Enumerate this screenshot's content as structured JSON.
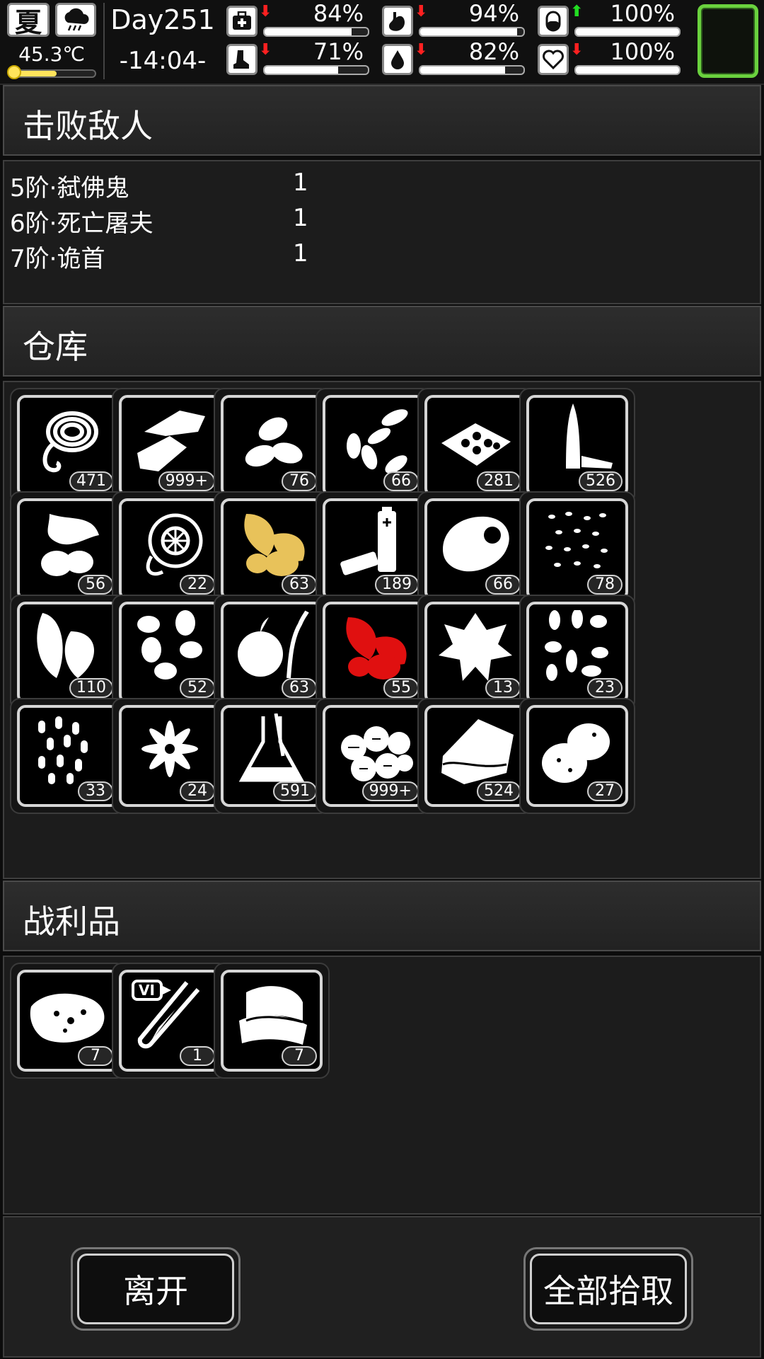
{
  "hud": {
    "season": "夏",
    "weather_icon": "storm-cloud-icon",
    "temperature": "45.3℃",
    "temperature_level": 0.55,
    "day": "Day251",
    "time": "-14:04-",
    "stats": [
      {
        "id": "health",
        "icon": "medkit-icon",
        "arrow": "down",
        "percent": "84%",
        "value": 0.84
      },
      {
        "id": "hunger",
        "icon": "stomach-icon",
        "arrow": "down",
        "percent": "94%",
        "value": 0.94
      },
      {
        "id": "sanity",
        "icon": "pill-icon",
        "arrow": "up",
        "percent": "100%",
        "value": 1.0
      },
      {
        "id": "stamina",
        "icon": "boot-icon",
        "arrow": "down",
        "percent": "71%",
        "value": 0.71
      },
      {
        "id": "thirst",
        "icon": "water-drop-icon",
        "arrow": "down",
        "percent": "82%",
        "value": 0.82
      },
      {
        "id": "mood",
        "icon": "heart-icon",
        "arrow": "down",
        "percent": "100%",
        "value": 1.0
      }
    ],
    "colors": {
      "arrow_down": "#ff2020",
      "arrow_up": "#22dd22",
      "portrait_frame": "#6ad13e",
      "temp_bar": "#ffe45c"
    }
  },
  "defeated": {
    "title": "击败敌人",
    "rows": [
      {
        "name": "5阶·弑佛鬼",
        "count": "1"
      },
      {
        "name": "6阶·死亡屠夫",
        "count": "1"
      },
      {
        "name": "7阶·诡首",
        "count": "1"
      }
    ]
  },
  "warehouse": {
    "title": "仓库",
    "items": [
      {
        "icon": "rope-icon",
        "count": "471"
      },
      {
        "icon": "cloth-scrap-icon",
        "count": "999+"
      },
      {
        "icon": "almond-icon",
        "count": "76"
      },
      {
        "icon": "seeds-icon",
        "count": "66"
      },
      {
        "icon": "tray-icon",
        "count": "281"
      },
      {
        "icon": "bullet-icon",
        "count": "526"
      },
      {
        "icon": "herb-pods-icon",
        "count": "56"
      },
      {
        "icon": "sliced-fruit-icon",
        "count": "22"
      },
      {
        "icon": "yellow-leaves-icon",
        "count": "63"
      },
      {
        "icon": "battery-icon",
        "count": "189"
      },
      {
        "icon": "meat-icon",
        "count": "66"
      },
      {
        "icon": "small-seeds-icon",
        "count": "78"
      },
      {
        "icon": "leaf-icon",
        "count": "110"
      },
      {
        "icon": "beans-icon",
        "count": "52"
      },
      {
        "icon": "root-vegetable-icon",
        "count": "63"
      },
      {
        "icon": "red-leaves-icon",
        "count": "55"
      },
      {
        "icon": "mint-icon",
        "count": "13"
      },
      {
        "icon": "sprouts-icon",
        "count": "23"
      },
      {
        "icon": "grain-icon",
        "count": "33"
      },
      {
        "icon": "flower-icon",
        "count": "24"
      },
      {
        "icon": "flask-icon",
        "count": "591"
      },
      {
        "icon": "cotton-balls-icon",
        "count": "999+"
      },
      {
        "icon": "fabric-icon",
        "count": "524"
      },
      {
        "icon": "potato-icon",
        "count": "27"
      }
    ],
    "colors": {
      "yellow_leaves": "#e8c25a",
      "red_leaves": "#e01010"
    }
  },
  "loot": {
    "title": "战利品",
    "items": [
      {
        "icon": "raw-meat-icon",
        "count": "7"
      },
      {
        "icon": "test-tube-icon",
        "count": "1",
        "tag": "VI"
      },
      {
        "icon": "cloth-stack-icon",
        "count": "7"
      }
    ]
  },
  "buttons": {
    "leave": "离开",
    "take_all": "全部拾取"
  }
}
